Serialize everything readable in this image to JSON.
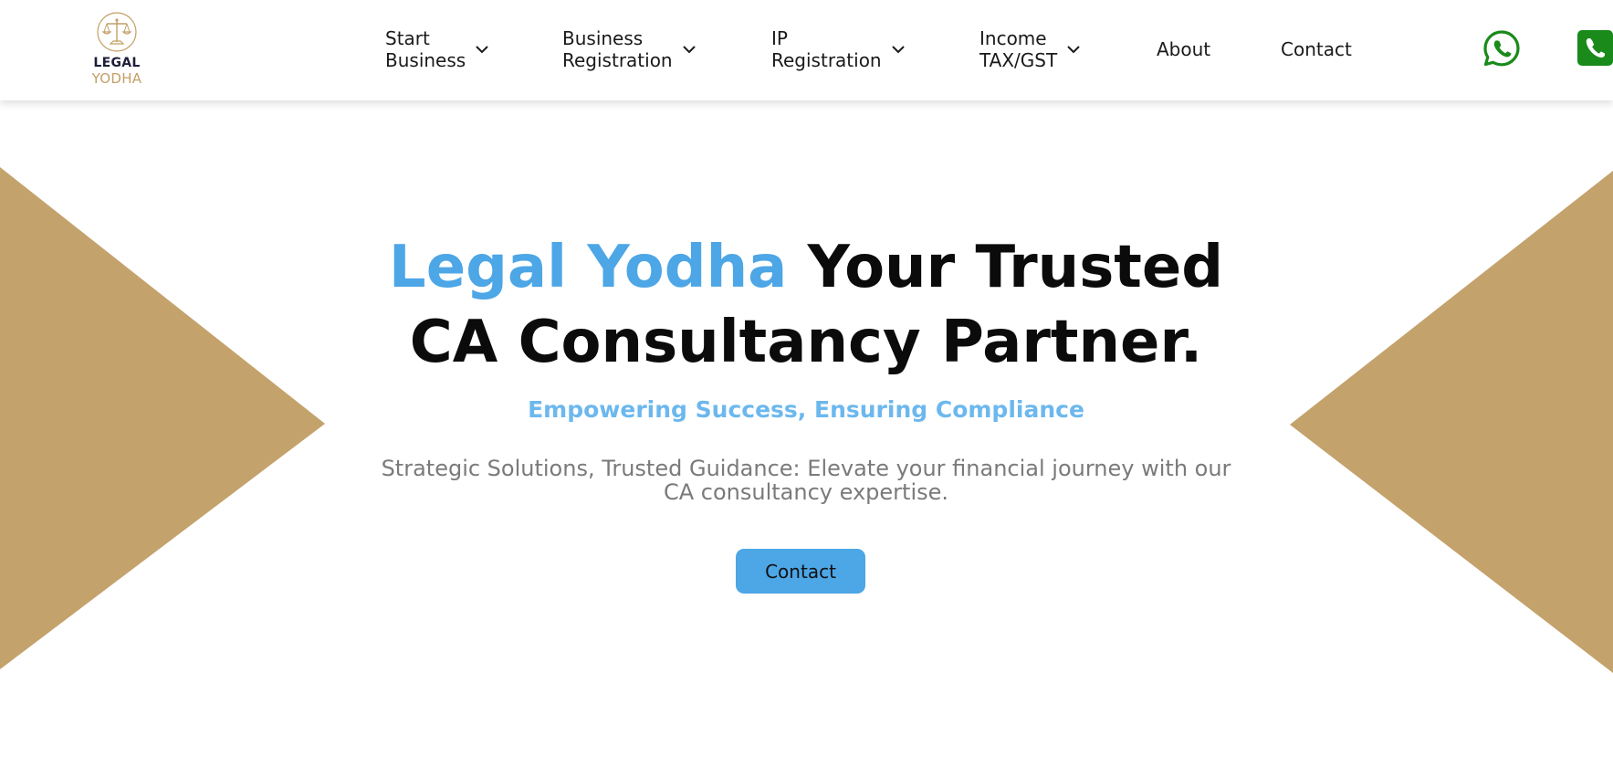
{
  "brand": {
    "line1": "LEGAL",
    "line2": "YODHA",
    "emblem_icon": "scales-of-justice-icon",
    "accent_color": "#c49f66"
  },
  "nav": {
    "items": [
      {
        "label": "Start\nBusiness",
        "has_dropdown": true
      },
      {
        "label": "Business\nRegistration",
        "has_dropdown": true
      },
      {
        "label": "IP\nRegistration",
        "has_dropdown": true
      },
      {
        "label": "Income\nTAX/GST",
        "has_dropdown": true
      },
      {
        "label": "About",
        "has_dropdown": false
      },
      {
        "label": "Contact",
        "has_dropdown": false
      }
    ],
    "whatsapp_icon": "whatsapp-icon",
    "phone_icon": "phone-icon",
    "icon_color": "#1a8a1a"
  },
  "hero": {
    "title_accent": "Legal Yodha",
    "title_rest": " Your Trusted CA Consultancy Partner.",
    "subtitle": "Empowering Success, Ensuring Compliance",
    "description": "Strategic Solutions, Trusted Guidance: Elevate your financial journey with our CA consultancy expertise.",
    "button_label": "Contact",
    "accent_color": "#4da6e6",
    "shape_color": "#c4a26c"
  }
}
